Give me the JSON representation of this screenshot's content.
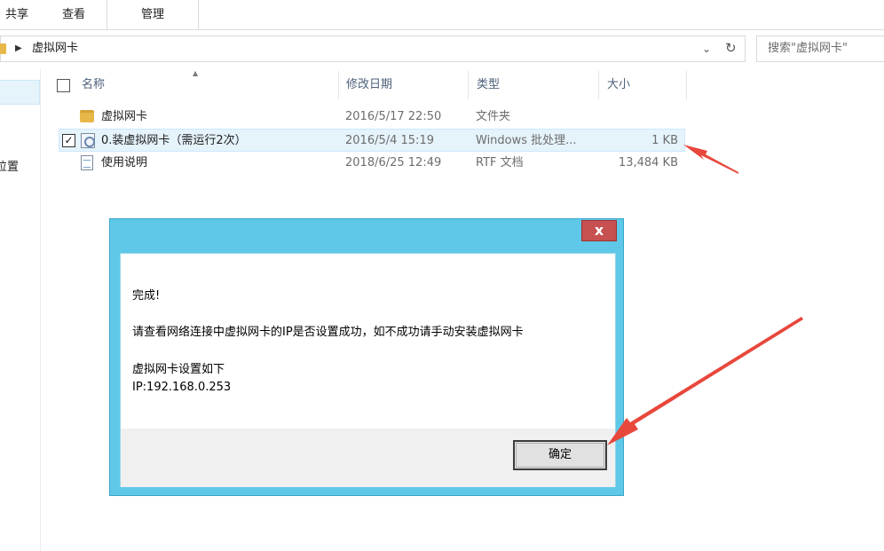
{
  "ribbon": {
    "tabs": [
      "共享",
      "查看",
      "管理"
    ]
  },
  "address": {
    "crumb": "虚拟网卡",
    "dropdown_glyph": "⌄",
    "refresh_glyph": "↻"
  },
  "search": {
    "placeholder": "搜索\"虚拟网卡\""
  },
  "nav": {
    "cut_label": "位置"
  },
  "columns": {
    "name": "名称",
    "date": "修改日期",
    "type": "类型",
    "size": "大小"
  },
  "files": [
    {
      "name": "虚拟网卡",
      "date": "2016/5/17 22:50",
      "type": "文件夹",
      "size": "",
      "icon": "folder-icon"
    },
    {
      "name": "0.装虚拟网卡（需运行2次）",
      "date": "2016/5/4 15:19",
      "type": "Windows 批处理...",
      "size": "1 KB",
      "icon": "batch-file-icon",
      "selected": true
    },
    {
      "name": "使用说明",
      "date": "2018/6/25 12:49",
      "type": "RTF 文档",
      "size": "13,484 KB",
      "icon": "document-icon"
    }
  ],
  "dialog": {
    "close_glyph": "x",
    "line1": "完成!",
    "line2": "请查看网络连接中虚拟网卡的IP是否设置成功，如不成功请手动安装虚拟网卡",
    "line3": "虚拟网卡设置如下",
    "line4": "IP:192.168.0.253",
    "ok_label": "确定"
  },
  "colors": {
    "dialog_frame": "#5fc8e8",
    "close_button": "#c75050",
    "arrow": "#e8473c",
    "selection": "#e5f3fb"
  }
}
